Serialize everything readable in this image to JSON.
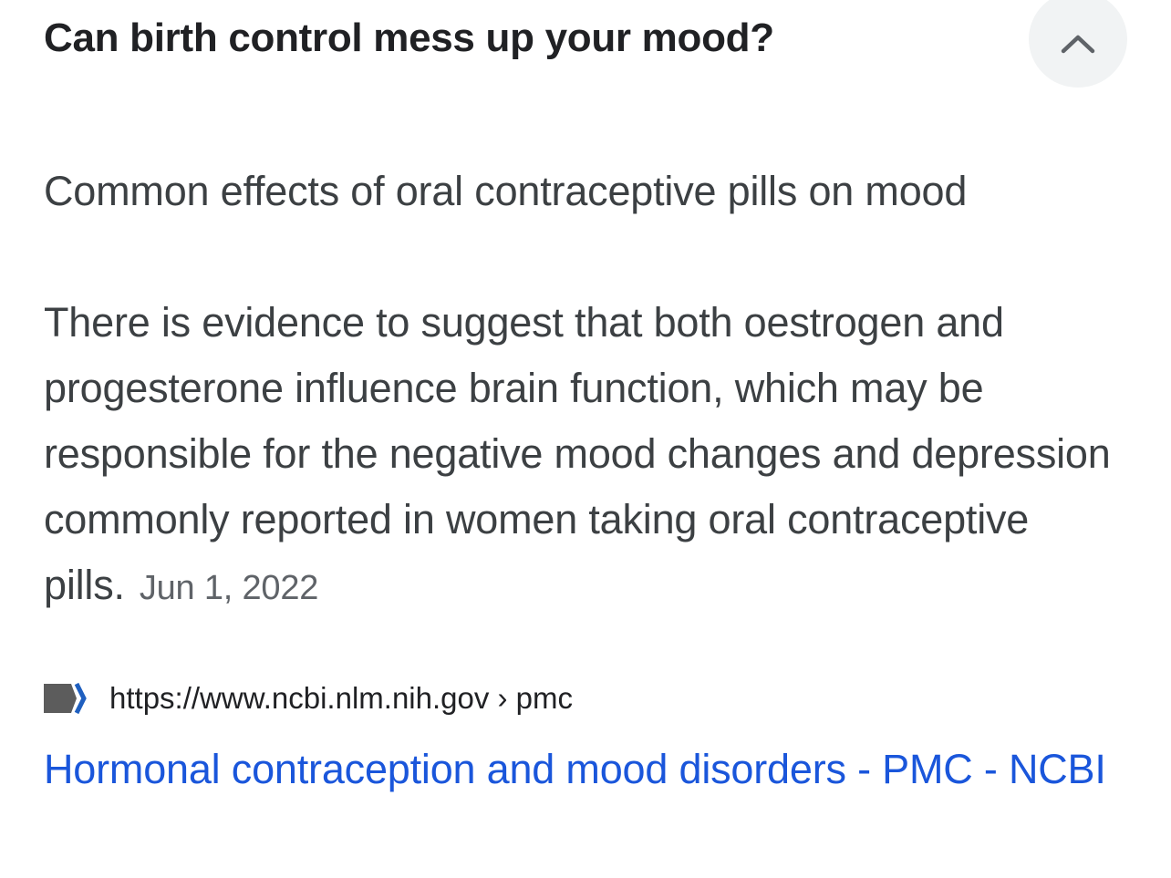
{
  "question": "Can birth control mess up your mood?",
  "collapse_icon": "chevron-up-icon",
  "answer": {
    "heading": "Common effects of oral contraceptive pills on mood",
    "snippet": "There is evidence to suggest that both oestrogen and progesterone influence brain function, which may be responsible for the negative mood changes and depression commonly reported in women taking oral contraceptive pills.",
    "date": "Jun 1, 2022"
  },
  "source": {
    "favicon_icon": "ncbi-logo-icon",
    "url": "https://www.ncbi.nlm.nih.gov › pmc",
    "title": "Hormonal contraception and mood disorders - PMC - NCBI"
  },
  "colors": {
    "link": "#1a56db",
    "text": "#3c4043",
    "heading": "#202124",
    "muted": "#5f6368",
    "button_bg": "#f1f3f4"
  }
}
